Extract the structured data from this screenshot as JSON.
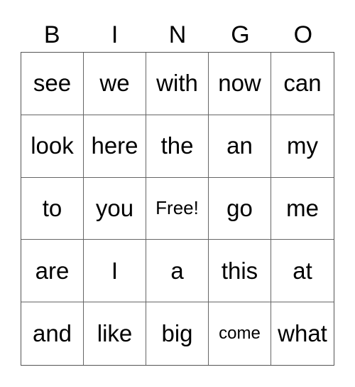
{
  "header": [
    "B",
    "I",
    "N",
    "G",
    "O"
  ],
  "rows": [
    [
      "see",
      "we",
      "with",
      "now",
      "can"
    ],
    [
      "look",
      "here",
      "the",
      "an",
      "my"
    ],
    [
      "to",
      "you",
      "Free!",
      "go",
      "me"
    ],
    [
      "are",
      "I",
      "a",
      "this",
      "at"
    ],
    [
      "and",
      "like",
      "big",
      "come",
      "what"
    ]
  ]
}
